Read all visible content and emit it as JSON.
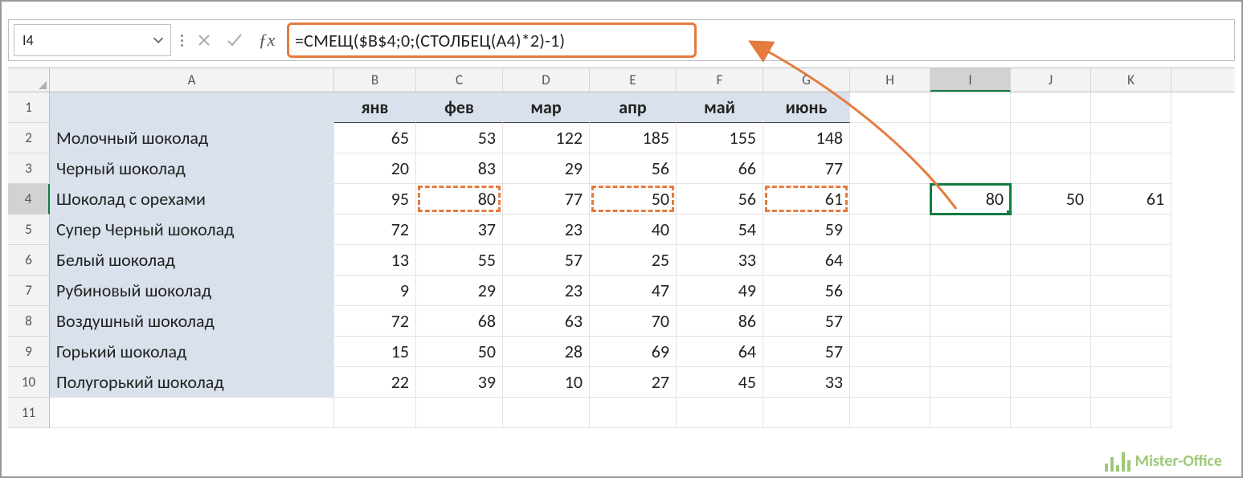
{
  "namebox": {
    "value": "I4"
  },
  "formula_bar": {
    "cancel_icon": "✕",
    "enter_icon": "✓",
    "fx_label": "ƒx",
    "formula": "=СМЕЩ($B$4;0;(СТОЛБЕЦ(A4)*2)-1)"
  },
  "columns": [
    "A",
    "B",
    "C",
    "D",
    "E",
    "F",
    "G",
    "H",
    "I",
    "J",
    "K"
  ],
  "col_widths_class": [
    "cA",
    "cB",
    "cC",
    "cD",
    "cE",
    "cF",
    "cG",
    "cH",
    "cI",
    "cJ",
    "cK"
  ],
  "active_col": "I",
  "active_row": 4,
  "header_row": [
    "",
    "янв",
    "фев",
    "мар",
    "апр",
    "май",
    "июнь",
    "",
    "",
    "",
    ""
  ],
  "data_rows": [
    {
      "label": "Молочный шоколад",
      "vals": [
        65,
        53,
        122,
        185,
        155,
        148
      ],
      "extra": [
        "",
        "",
        "",
        ""
      ]
    },
    {
      "label": "Черный шоколад",
      "vals": [
        20,
        83,
        29,
        56,
        66,
        77
      ],
      "extra": [
        "",
        "",
        "",
        ""
      ]
    },
    {
      "label": "Шоколад с орехами",
      "vals": [
        95,
        80,
        77,
        50,
        56,
        61
      ],
      "extra": [
        "",
        80,
        50,
        61
      ]
    },
    {
      "label": "Супер Черный шоколад",
      "vals": [
        72,
        37,
        23,
        40,
        54,
        59
      ],
      "extra": [
        "",
        "",
        "",
        ""
      ]
    },
    {
      "label": "Белый шоколад",
      "vals": [
        13,
        55,
        57,
        25,
        33,
        64
      ],
      "extra": [
        "",
        "",
        "",
        ""
      ]
    },
    {
      "label": "Рубиновый шоколад",
      "vals": [
        9,
        29,
        23,
        47,
        49,
        56
      ],
      "extra": [
        "",
        "",
        "",
        ""
      ]
    },
    {
      "label": "Воздушный шоколад",
      "vals": [
        72,
        68,
        63,
        70,
        86,
        57
      ],
      "extra": [
        "",
        "",
        "",
        ""
      ]
    },
    {
      "label": "Горький шоколад",
      "vals": [
        15,
        50,
        28,
        69,
        64,
        57
      ],
      "extra": [
        "",
        "",
        "",
        ""
      ]
    },
    {
      "label": "Полугорький шоколад",
      "vals": [
        22,
        39,
        10,
        27,
        45,
        33
      ],
      "extra": [
        "",
        "",
        "",
        ""
      ]
    }
  ],
  "highlight_dashed": [
    {
      "r": 4,
      "c": "C"
    },
    {
      "r": 4,
      "c": "E"
    },
    {
      "r": 4,
      "c": "G"
    }
  ],
  "selected_cell": {
    "r": 4,
    "c": "I"
  },
  "watermark": {
    "text": "Mister-Office"
  }
}
